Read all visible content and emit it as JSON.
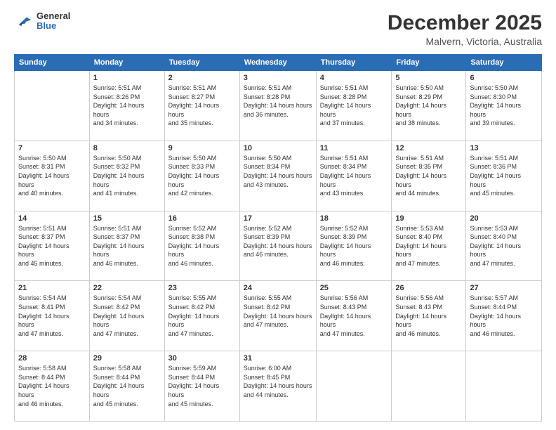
{
  "logo": {
    "general": "General",
    "blue": "Blue"
  },
  "title": {
    "month_year": "December 2025",
    "location": "Malvern, Victoria, Australia"
  },
  "headers": [
    "Sunday",
    "Monday",
    "Tuesday",
    "Wednesday",
    "Thursday",
    "Friday",
    "Saturday"
  ],
  "weeks": [
    [
      {
        "day": "",
        "sunrise": "",
        "sunset": "",
        "daylight": ""
      },
      {
        "day": "1",
        "sunrise": "Sunrise: 5:51 AM",
        "sunset": "Sunset: 8:26 PM",
        "daylight": "Daylight: 14 hours and 34 minutes."
      },
      {
        "day": "2",
        "sunrise": "Sunrise: 5:51 AM",
        "sunset": "Sunset: 8:27 PM",
        "daylight": "Daylight: 14 hours and 35 minutes."
      },
      {
        "day": "3",
        "sunrise": "Sunrise: 5:51 AM",
        "sunset": "Sunset: 8:28 PM",
        "daylight": "Daylight: 14 hours and 36 minutes."
      },
      {
        "day": "4",
        "sunrise": "Sunrise: 5:51 AM",
        "sunset": "Sunset: 8:28 PM",
        "daylight": "Daylight: 14 hours and 37 minutes."
      },
      {
        "day": "5",
        "sunrise": "Sunrise: 5:50 AM",
        "sunset": "Sunset: 8:29 PM",
        "daylight": "Daylight: 14 hours and 38 minutes."
      },
      {
        "day": "6",
        "sunrise": "Sunrise: 5:50 AM",
        "sunset": "Sunset: 8:30 PM",
        "daylight": "Daylight: 14 hours and 39 minutes."
      }
    ],
    [
      {
        "day": "7",
        "sunrise": "Sunrise: 5:50 AM",
        "sunset": "Sunset: 8:31 PM",
        "daylight": "Daylight: 14 hours and 40 minutes."
      },
      {
        "day": "8",
        "sunrise": "Sunrise: 5:50 AM",
        "sunset": "Sunset: 8:32 PM",
        "daylight": "Daylight: 14 hours and 41 minutes."
      },
      {
        "day": "9",
        "sunrise": "Sunrise: 5:50 AM",
        "sunset": "Sunset: 8:33 PM",
        "daylight": "Daylight: 14 hours and 42 minutes."
      },
      {
        "day": "10",
        "sunrise": "Sunrise: 5:50 AM",
        "sunset": "Sunset: 8:34 PM",
        "daylight": "Daylight: 14 hours and 43 minutes."
      },
      {
        "day": "11",
        "sunrise": "Sunrise: 5:51 AM",
        "sunset": "Sunset: 8:34 PM",
        "daylight": "Daylight: 14 hours and 43 minutes."
      },
      {
        "day": "12",
        "sunrise": "Sunrise: 5:51 AM",
        "sunset": "Sunset: 8:35 PM",
        "daylight": "Daylight: 14 hours and 44 minutes."
      },
      {
        "day": "13",
        "sunrise": "Sunrise: 5:51 AM",
        "sunset": "Sunset: 8:36 PM",
        "daylight": "Daylight: 14 hours and 45 minutes."
      }
    ],
    [
      {
        "day": "14",
        "sunrise": "Sunrise: 5:51 AM",
        "sunset": "Sunset: 8:37 PM",
        "daylight": "Daylight: 14 hours and 45 minutes."
      },
      {
        "day": "15",
        "sunrise": "Sunrise: 5:51 AM",
        "sunset": "Sunset: 8:37 PM",
        "daylight": "Daylight: 14 hours and 46 minutes."
      },
      {
        "day": "16",
        "sunrise": "Sunrise: 5:52 AM",
        "sunset": "Sunset: 8:38 PM",
        "daylight": "Daylight: 14 hours and 46 minutes."
      },
      {
        "day": "17",
        "sunrise": "Sunrise: 5:52 AM",
        "sunset": "Sunset: 8:39 PM",
        "daylight": "Daylight: 14 hours and 46 minutes."
      },
      {
        "day": "18",
        "sunrise": "Sunrise: 5:52 AM",
        "sunset": "Sunset: 8:39 PM",
        "daylight": "Daylight: 14 hours and 46 minutes."
      },
      {
        "day": "19",
        "sunrise": "Sunrise: 5:53 AM",
        "sunset": "Sunset: 8:40 PM",
        "daylight": "Daylight: 14 hours and 47 minutes."
      },
      {
        "day": "20",
        "sunrise": "Sunrise: 5:53 AM",
        "sunset": "Sunset: 8:40 PM",
        "daylight": "Daylight: 14 hours and 47 minutes."
      }
    ],
    [
      {
        "day": "21",
        "sunrise": "Sunrise: 5:54 AM",
        "sunset": "Sunset: 8:41 PM",
        "daylight": "Daylight: 14 hours and 47 minutes."
      },
      {
        "day": "22",
        "sunrise": "Sunrise: 5:54 AM",
        "sunset": "Sunset: 8:42 PM",
        "daylight": "Daylight: 14 hours and 47 minutes."
      },
      {
        "day": "23",
        "sunrise": "Sunrise: 5:55 AM",
        "sunset": "Sunset: 8:42 PM",
        "daylight": "Daylight: 14 hours and 47 minutes."
      },
      {
        "day": "24",
        "sunrise": "Sunrise: 5:55 AM",
        "sunset": "Sunset: 8:42 PM",
        "daylight": "Daylight: 14 hours and 47 minutes."
      },
      {
        "day": "25",
        "sunrise": "Sunrise: 5:56 AM",
        "sunset": "Sunset: 8:43 PM",
        "daylight": "Daylight: 14 hours and 47 minutes."
      },
      {
        "day": "26",
        "sunrise": "Sunrise: 5:56 AM",
        "sunset": "Sunset: 8:43 PM",
        "daylight": "Daylight: 14 hours and 46 minutes."
      },
      {
        "day": "27",
        "sunrise": "Sunrise: 5:57 AM",
        "sunset": "Sunset: 8:44 PM",
        "daylight": "Daylight: 14 hours and 46 minutes."
      }
    ],
    [
      {
        "day": "28",
        "sunrise": "Sunrise: 5:58 AM",
        "sunset": "Sunset: 8:44 PM",
        "daylight": "Daylight: 14 hours and 46 minutes."
      },
      {
        "day": "29",
        "sunrise": "Sunrise: 5:58 AM",
        "sunset": "Sunset: 8:44 PM",
        "daylight": "Daylight: 14 hours and 45 minutes."
      },
      {
        "day": "30",
        "sunrise": "Sunrise: 5:59 AM",
        "sunset": "Sunset: 8:44 PM",
        "daylight": "Daylight: 14 hours and 45 minutes."
      },
      {
        "day": "31",
        "sunrise": "Sunrise: 6:00 AM",
        "sunset": "Sunset: 8:45 PM",
        "daylight": "Daylight: 14 hours and 44 minutes."
      },
      {
        "day": "",
        "sunrise": "",
        "sunset": "",
        "daylight": ""
      },
      {
        "day": "",
        "sunrise": "",
        "sunset": "",
        "daylight": ""
      },
      {
        "day": "",
        "sunrise": "",
        "sunset": "",
        "daylight": ""
      }
    ]
  ]
}
